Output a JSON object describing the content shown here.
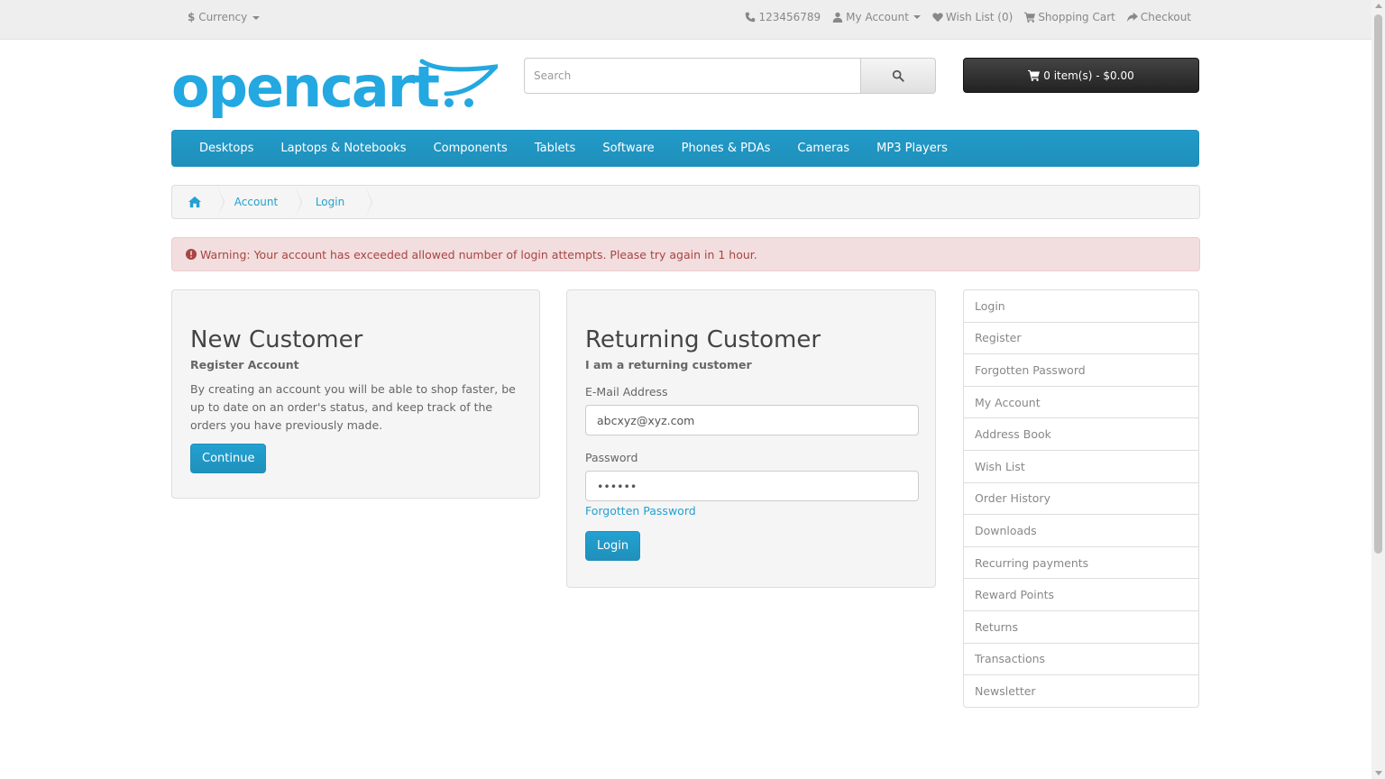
{
  "topbar": {
    "currency_symbol": "$",
    "currency_label": "Currency",
    "phone": "123456789",
    "my_account": "My Account",
    "wish_list": "Wish List (0)",
    "shopping_cart": "Shopping Cart",
    "checkout": "Checkout"
  },
  "header": {
    "logo_text": "opencart",
    "search_placeholder": "Search",
    "cart_button": "0 item(s) - $0.00"
  },
  "menu": {
    "items": [
      "Desktops",
      "Laptops & Notebooks",
      "Components",
      "Tablets",
      "Software",
      "Phones & PDAs",
      "Cameras",
      "MP3 Players"
    ]
  },
  "breadcrumb": {
    "items": [
      "Account",
      "Login"
    ]
  },
  "alert": {
    "text": "Warning: Your account has exceeded allowed number of login attempts. Please try again in 1 hour."
  },
  "new_customer": {
    "title": "New Customer",
    "subtitle": "Register Account",
    "description": "By creating an account you will be able to shop faster, be up to date on an order's status, and keep track of the orders you have previously made.",
    "button": "Continue"
  },
  "returning_customer": {
    "title": "Returning Customer",
    "subtitle": "I am a returning customer",
    "email_label": "E-Mail Address",
    "email_value": "abcxyz@xyz.com",
    "password_label": "Password",
    "password_value": "••••••",
    "forgotten_link": "Forgotten Password",
    "button": "Login"
  },
  "account_menu": {
    "items": [
      "Login",
      "Register",
      "Forgotten Password",
      "My Account",
      "Address Book",
      "Wish List",
      "Order History",
      "Downloads",
      "Recurring payments",
      "Reward Points",
      "Returns",
      "Transactions",
      "Newsletter"
    ]
  },
  "colors": {
    "brand_blue": "#229ac8",
    "link_blue": "#23a1d1",
    "alert_bg": "#f2dede",
    "alert_text": "#a94442"
  }
}
